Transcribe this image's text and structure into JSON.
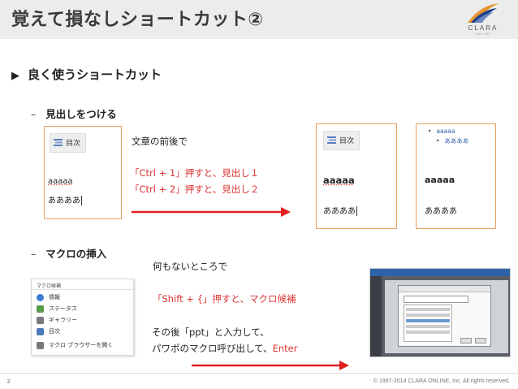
{
  "slide": {
    "title": "覚えて損なしショートカット②",
    "page_number": "3",
    "copyright": "© 1997-2014 CLARA ONLINE, Inc. All rights reserved."
  },
  "logo": {
    "text": "CLARA",
    "subtext": "ONLINE",
    "colors": {
      "blue": "#1d3f86",
      "orange": "#e8932b"
    }
  },
  "section": {
    "heading": "良く使うショートカット",
    "marker_icon": "triangle-right"
  },
  "heading_section": {
    "title": "見出しをつける",
    "toc_button": "目次",
    "sample_text_1": "aaaaa",
    "sample_text_2": "ああああ",
    "before_after": "文章の前後で",
    "line_h1": "「Ctrl + 1」押すと、見出し１",
    "line_h2": "「Ctrl + 2」押すと、見出し２",
    "result1": {
      "toc_button": "目次",
      "heading": "aaaaa",
      "body": "ああああ"
    },
    "result2": {
      "list_item": "aaaaa",
      "list_subitem": "ああああ",
      "heading": "aaaaa",
      "body": "ああああ"
    }
  },
  "macro_section": {
    "title": "マクロの挿入",
    "nothing_there": "何もないところで",
    "shift_line": "「Shift + {」押すと、マクロ候補",
    "then_line": "その後「ppt」と入力して、",
    "call_line_prefix": "パワポのマクロ呼び出して、",
    "call_line_enter": "Enter",
    "menu": {
      "title": "マクロ候補",
      "items": [
        {
          "label": "情報",
          "icon": "info-icon",
          "color": "#3a7bd5"
        },
        {
          "label": "ステータス",
          "icon": "status-icon",
          "color": "#5a9a4a"
        },
        {
          "label": "ギャラリー",
          "icon": "gallery-icon",
          "color": "#7a7a7a"
        },
        {
          "label": "目次",
          "icon": "toc-icon",
          "color": "#4a7ab8"
        },
        {
          "label": "マクロ ブラウザーを開く",
          "icon": "macro-browser-icon",
          "color": "#777777"
        }
      ]
    }
  },
  "colors": {
    "frame": "#e8a060",
    "arrow": "#e02020",
    "accent_red": "#dd3333"
  }
}
